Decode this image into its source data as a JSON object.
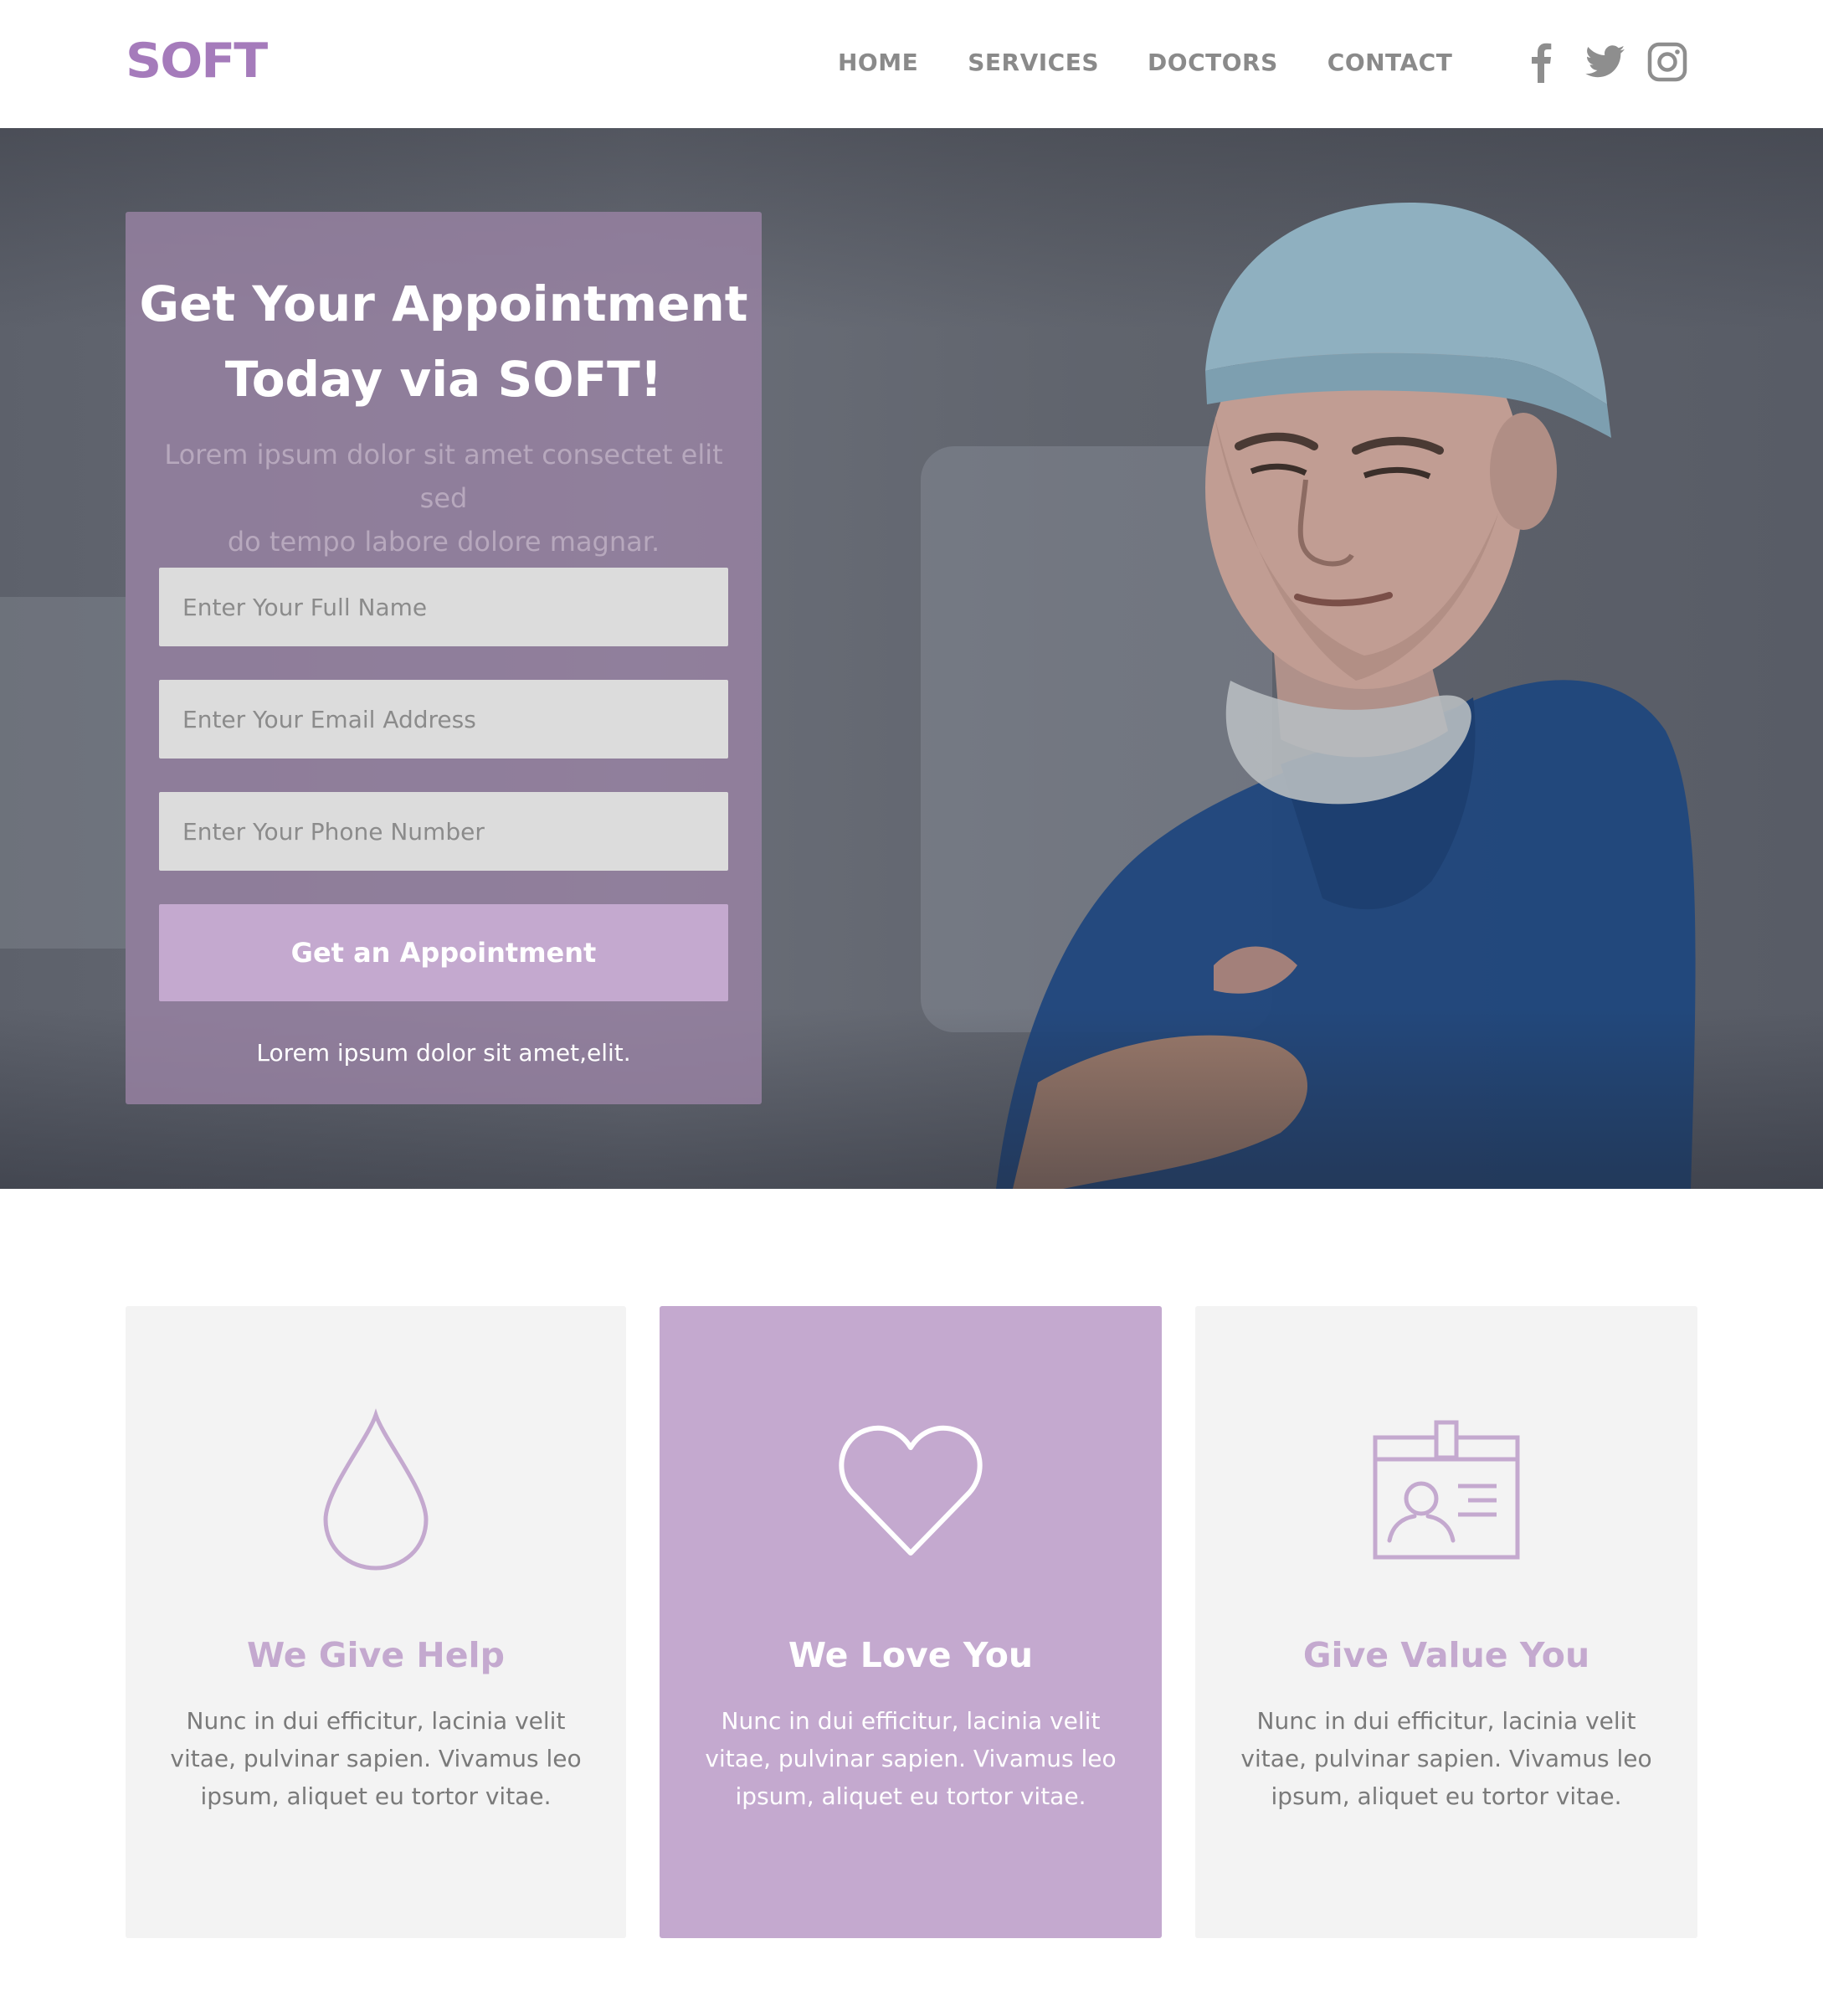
{
  "brand": {
    "logo": "SOFT",
    "accent": "#c4a9cf",
    "logo_color": "#a57bbb"
  },
  "nav": {
    "home": "HOME",
    "services": "SERVICES",
    "doctors": "DOCTORS",
    "contact": "CONTACT"
  },
  "social": [
    "facebook-icon",
    "twitter-icon",
    "instagram-icon"
  ],
  "hero": {
    "title_line1": "Get Your Appointment",
    "title_line2": "Today via SOFT!",
    "subtitle_line1": "Lorem ipsum dolor sit amet consectet elit sed",
    "subtitle_line2": "do tempo labore dolore magnar.",
    "name_placeholder": "Enter Your Full Name",
    "email_placeholder": "Enter Your Email Address",
    "phone_placeholder": "Enter Your Phone Number",
    "button": "Get an Appointment",
    "note": "Lorem ipsum dolor sit amet,elit."
  },
  "features": [
    {
      "icon": "drop-icon",
      "title": "We Give Help",
      "text": "Nunc in dui efficitur, lacinia velit vitae, pulvinar sapien. Vivamus leo ipsum, aliquet eu tortor vitae."
    },
    {
      "icon": "heart-icon",
      "title": "We Love You",
      "text": "Nunc in dui efficitur, lacinia velit vitae, pulvinar sapien. Vivamus leo ipsum, aliquet eu tortor vitae."
    },
    {
      "icon": "id-badge-icon",
      "title": "Give Value You",
      "text": "Nunc in dui efficitur, lacinia velit vitae, pulvinar sapien. Vivamus leo ipsum, aliquet eu tortor vitae."
    }
  ]
}
